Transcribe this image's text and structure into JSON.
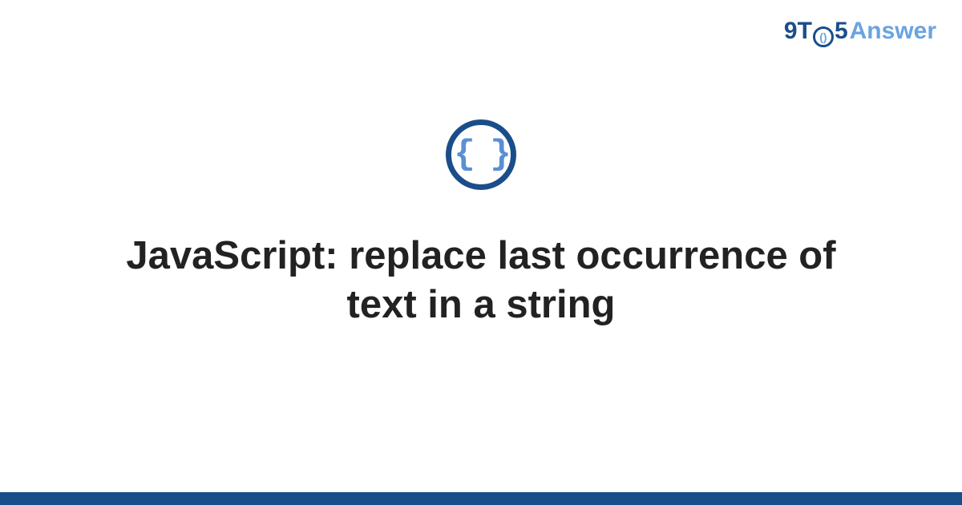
{
  "logo": {
    "part1": "9T",
    "clock_inner": "()",
    "part2": "5",
    "part3": "Answer"
  },
  "icon": {
    "name": "code-braces-icon",
    "glyph": "{ }"
  },
  "title": "JavaScript: replace last occurrence of text in a string",
  "colors": {
    "primary_dark": "#1a4e8a",
    "primary_light": "#6aa3e0",
    "text": "#222222"
  }
}
